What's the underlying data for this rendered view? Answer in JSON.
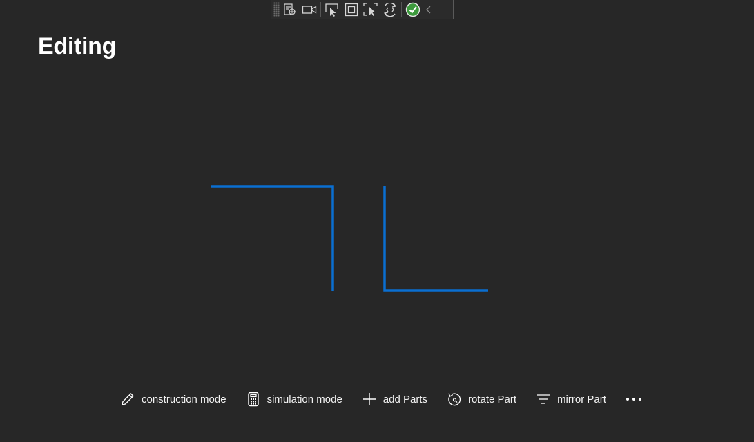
{
  "header": {
    "title": "Editing"
  },
  "dev_toolbar": {
    "buttons": [
      {
        "id": "live-visual-tree",
        "icon": "live-visual-tree-icon"
      },
      {
        "id": "record",
        "icon": "video-camera-icon"
      },
      {
        "id": "select-element",
        "icon": "select-element-icon"
      },
      {
        "id": "display-layout-adorners",
        "icon": "layout-adorner-icon"
      },
      {
        "id": "track-focus",
        "icon": "track-focus-icon"
      },
      {
        "id": "hot-reload",
        "icon": "hot-reload-icon"
      },
      {
        "id": "binding-status",
        "icon": "green-check-icon"
      },
      {
        "id": "collapse",
        "icon": "chevron-left-icon"
      }
    ],
    "status_color": "#3c9a3c"
  },
  "canvas": {
    "stroke_color": "#0a6fd1",
    "parts": [
      {
        "name": "corner-part-left",
        "orientation": "top-right"
      },
      {
        "name": "corner-part-right",
        "orientation": "bottom-left"
      }
    ]
  },
  "command_bar": {
    "items": [
      {
        "label": "construction mode",
        "icon": "pencil-icon"
      },
      {
        "label": "simulation mode",
        "icon": "calculator-icon"
      },
      {
        "label": "add Parts",
        "icon": "plus-icon"
      },
      {
        "label": "rotate Part",
        "icon": "rotate-icon"
      },
      {
        "label": "mirror Part",
        "icon": "mirror-lines-icon"
      }
    ],
    "more_icon": "more-ellipsis-icon"
  }
}
